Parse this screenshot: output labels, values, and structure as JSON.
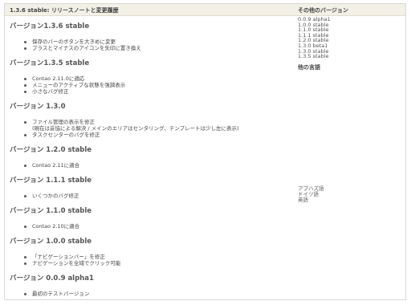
{
  "page": {
    "title": "1.3.6 stable: リリースノートと変更履歴"
  },
  "versions": [
    {
      "title": "バージョン1.3.6 stable",
      "items": [
        "保存のバーのボタンを大きめに変更",
        "プラスとマイナスのアイコンを矢印に置き換え"
      ]
    },
    {
      "title": "バージョン1.3.5 stable",
      "items": [
        "Contao 2.11.0に適応",
        "メニューのアクティブな状態を強調表示",
        "小さなバグ修正"
      ]
    },
    {
      "title": "バージョン 1.3.0",
      "items": [
        "ファイル管理の表示を修正\n(現在は妥協による解決 / メインのエリアはセンタリング、テンプレートは少し左に表示)",
        "タスクセンターのバグを修正"
      ]
    },
    {
      "title": "バージョン 1.2.0 stable",
      "items": [
        "Contao 2.11に適合"
      ]
    },
    {
      "title": "バージョン 1.1.1 stable",
      "items": [
        "いくつかのバグ修正"
      ]
    },
    {
      "title": "バージョン 1.1.0 stable",
      "items": [
        "Contao 2.10に適合"
      ]
    },
    {
      "title": "バージョン 1.0.0 stable",
      "items": [
        "「ナビゲーションバー」を修正",
        "ナビゲーションを全域でクリック可能"
      ]
    },
    {
      "title": "バージョン 0.0.9 alpha1",
      "items": [
        "最初のテストバージョン"
      ]
    }
  ],
  "sidebar": {
    "other_versions_title": "その他のバージョン",
    "other_versions": [
      "0.0.9 alpha1",
      "1.0.0 stable",
      "1.1.0 stable",
      "1.1.1 stable",
      "1.2.0 stable",
      "1.3.0 beta1",
      "1.3.0 stable",
      "1.3.5 stable"
    ],
    "languages_title": "他の言語",
    "languages": [
      "アブハズ語",
      "ドイツ語",
      "英語"
    ]
  }
}
